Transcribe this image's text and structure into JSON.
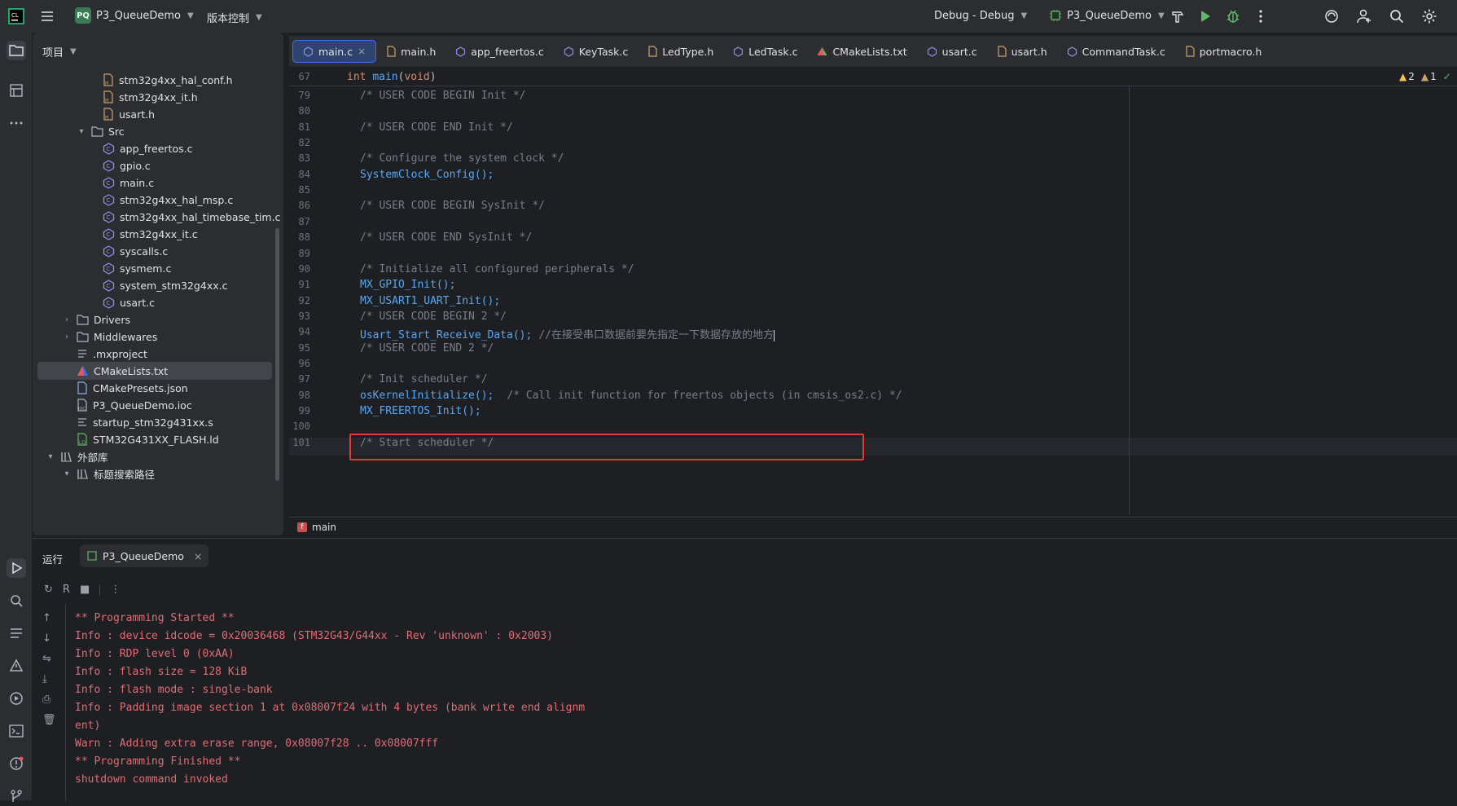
{
  "titlebar": {
    "project_badge": "PQ",
    "project_name": "P3_QueueDemo",
    "vcs_label": "版本控制",
    "run_config": "Debug - Debug",
    "target": "P3_QueueDemo"
  },
  "project_panel": {
    "title": "项目",
    "tree": [
      {
        "label": "stm32g4xx_hal_conf.h",
        "kind": "h"
      },
      {
        "label": "stm32g4xx_it.h",
        "kind": "h"
      },
      {
        "label": "usart.h",
        "kind": "h"
      },
      {
        "label": "Src",
        "kind": "folder"
      },
      {
        "label": "app_freertos.c",
        "kind": "c"
      },
      {
        "label": "gpio.c",
        "kind": "c"
      },
      {
        "label": "main.c",
        "kind": "c"
      },
      {
        "label": "stm32g4xx_hal_msp.c",
        "kind": "c"
      },
      {
        "label": "stm32g4xx_hal_timebase_tim.c",
        "kind": "c"
      },
      {
        "label": "stm32g4xx_it.c",
        "kind": "c"
      },
      {
        "label": "syscalls.c",
        "kind": "c"
      },
      {
        "label": "sysmem.c",
        "kind": "c"
      },
      {
        "label": "system_stm32g4xx.c",
        "kind": "c"
      },
      {
        "label": "usart.c",
        "kind": "c"
      },
      {
        "label": "Drivers",
        "kind": "folder"
      },
      {
        "label": "Middlewares",
        "kind": "folder"
      },
      {
        "label": ".mxproject",
        "kind": "text"
      },
      {
        "label": "CMakeLists.txt",
        "kind": "cmake"
      },
      {
        "label": "CMakePresets.json",
        "kind": "json"
      },
      {
        "label": "P3_QueueDemo.ioc",
        "kind": "ioc"
      },
      {
        "label": "startup_stm32g431xx.s",
        "kind": "asm"
      },
      {
        "label": "STM32G431XX_FLASH.ld",
        "kind": "ld"
      },
      {
        "label": "外部库",
        "kind": "lib"
      },
      {
        "label": "标题搜索路径",
        "kind": "lib"
      }
    ]
  },
  "tabs": [
    {
      "label": "main.c"
    },
    {
      "label": "main.h"
    },
    {
      "label": "app_freertos.c"
    },
    {
      "label": "KeyTask.c"
    },
    {
      "label": "LedType.h"
    },
    {
      "label": "LedTask.c"
    },
    {
      "label": "CMakeLists.txt"
    },
    {
      "label": "usart.c"
    },
    {
      "label": "usart.h"
    },
    {
      "label": "CommandTask.c"
    },
    {
      "label": "portmacro.h"
    }
  ],
  "inspections": {
    "warnings": "2",
    "weak_warnings": "1"
  },
  "editor": {
    "sticky_line": "67",
    "sticky_code": "int main(void)",
    "lines": [
      {
        "n": "79",
        "code": "/* USER CODE BEGIN Init */"
      },
      {
        "n": "80",
        "code": ""
      },
      {
        "n": "81",
        "code": "/* USER CODE END Init */"
      },
      {
        "n": "82",
        "code": ""
      },
      {
        "n": "83",
        "code": "/* Configure the system clock */"
      },
      {
        "n": "84",
        "code": "SystemClock_Config();"
      },
      {
        "n": "85",
        "code": ""
      },
      {
        "n": "86",
        "code": "/* USER CODE BEGIN SysInit */"
      },
      {
        "n": "87",
        "code": ""
      },
      {
        "n": "88",
        "code": "/* USER CODE END SysInit */"
      },
      {
        "n": "89",
        "code": ""
      },
      {
        "n": "90",
        "code": "/* Initialize all configured peripherals */"
      },
      {
        "n": "91",
        "code": "MX_GPIO_Init();"
      },
      {
        "n": "92",
        "code": "MX_USART1_UART_Init();"
      },
      {
        "n": "93",
        "code": "/* USER CODE BEGIN 2 */"
      },
      {
        "n": "94",
        "code": "Usart_Start_Receive_Data();"
      },
      {
        "n": "95",
        "code": "/* USER CODE END 2 */"
      },
      {
        "n": "96",
        "code": ""
      },
      {
        "n": "97",
        "code": "/* Init scheduler */"
      },
      {
        "n": "98",
        "code": "osKernelInitialize();"
      },
      {
        "n": "99",
        "code": "MX_FREERTOS_Init();"
      },
      {
        "n": "100",
        "code": ""
      },
      {
        "n": "101",
        "code": "/* Start scheduler */"
      }
    ],
    "line94_comment": "//在接受串口数据前要先指定一下数据存放的地方",
    "line98_comment": "/* Call init function for freertos objects (in cmsis_os2.c) */",
    "breadcrumb": "main"
  },
  "run": {
    "title": "运行",
    "tab_label": "P3_QueueDemo",
    "console": [
      "** Programming Started **",
      "Info : device idcode = 0x20036468 (STM32G43/G44xx - Rev 'unknown' : 0x2003)",
      "Info : RDP level 0 (0xAA)",
      "Info : flash size = 128 KiB",
      "Info : flash mode : single-bank",
      "Info : Padding image section 1 at 0x08007f24 with 4 bytes (bank write end alignm",
      "ent)",
      "Warn : Adding extra erase range, 0x08007f28 .. 0x08007fff",
      "** Programming Finished **",
      "shutdown command invoked"
    ]
  },
  "colors": {
    "accent": "#3574f0",
    "console_error": "#e06c75",
    "highlight_box": "#e53935"
  }
}
